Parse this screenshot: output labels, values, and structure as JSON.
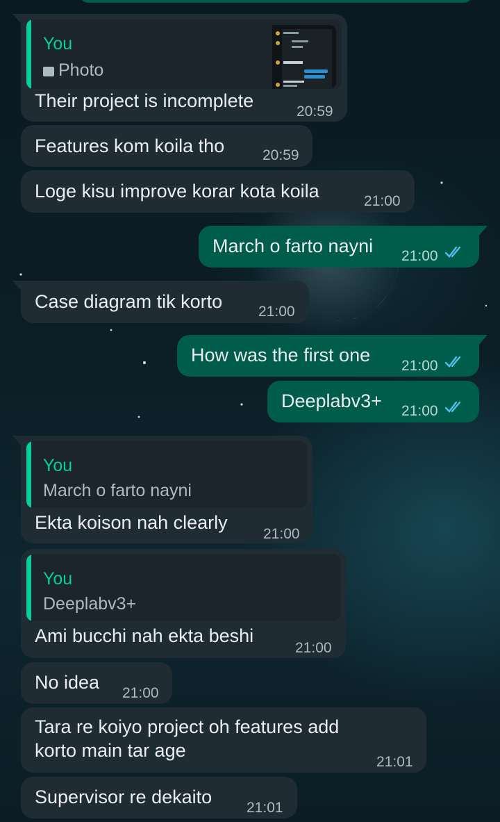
{
  "colors": {
    "incoming_bubble": "#202c33",
    "outgoing_bubble": "#005c4b",
    "quote_accent": "#06cf9c",
    "read_ticks": "#53bdeb",
    "timestamp": "#aebac1"
  },
  "messages": [
    {
      "direction": "incoming",
      "reply_to": {
        "author": "You",
        "kind_icon": "photo-icon",
        "text": "Photo",
        "has_thumbnail": true
      },
      "text": "Their project is incomplete",
      "time": "20:59"
    },
    {
      "direction": "incoming",
      "text": "Features kom koila tho",
      "time": "20:59"
    },
    {
      "direction": "incoming",
      "text": "Loge kisu improve korar kota koila",
      "time": "21:00"
    },
    {
      "direction": "outgoing",
      "text": "March o farto nayni",
      "time": "21:00",
      "status": "read"
    },
    {
      "direction": "incoming",
      "text": "Case diagram tik korto",
      "time": "21:00"
    },
    {
      "direction": "outgoing",
      "text": "How was the first one",
      "time": "21:00",
      "status": "read"
    },
    {
      "direction": "outgoing",
      "text": "Deeplabv3+",
      "time": "21:00",
      "status": "read"
    },
    {
      "direction": "incoming",
      "reply_to": {
        "author": "You",
        "text": "March o farto nayni"
      },
      "text": "Ekta koison nah clearly",
      "time": "21:00"
    },
    {
      "direction": "incoming",
      "reply_to": {
        "author": "You",
        "text": "Deeplabv3+"
      },
      "text": "Ami bucchi nah ekta beshi",
      "time": "21:00"
    },
    {
      "direction": "incoming",
      "text": "No idea",
      "time": "21:00"
    },
    {
      "direction": "incoming",
      "text_lines": [
        "Tara re koiyo project oh features add",
        "korto main tar age"
      ],
      "time": "21:01"
    },
    {
      "direction": "incoming",
      "text": "Supervisor re dekaito",
      "time": "21:01"
    }
  ]
}
